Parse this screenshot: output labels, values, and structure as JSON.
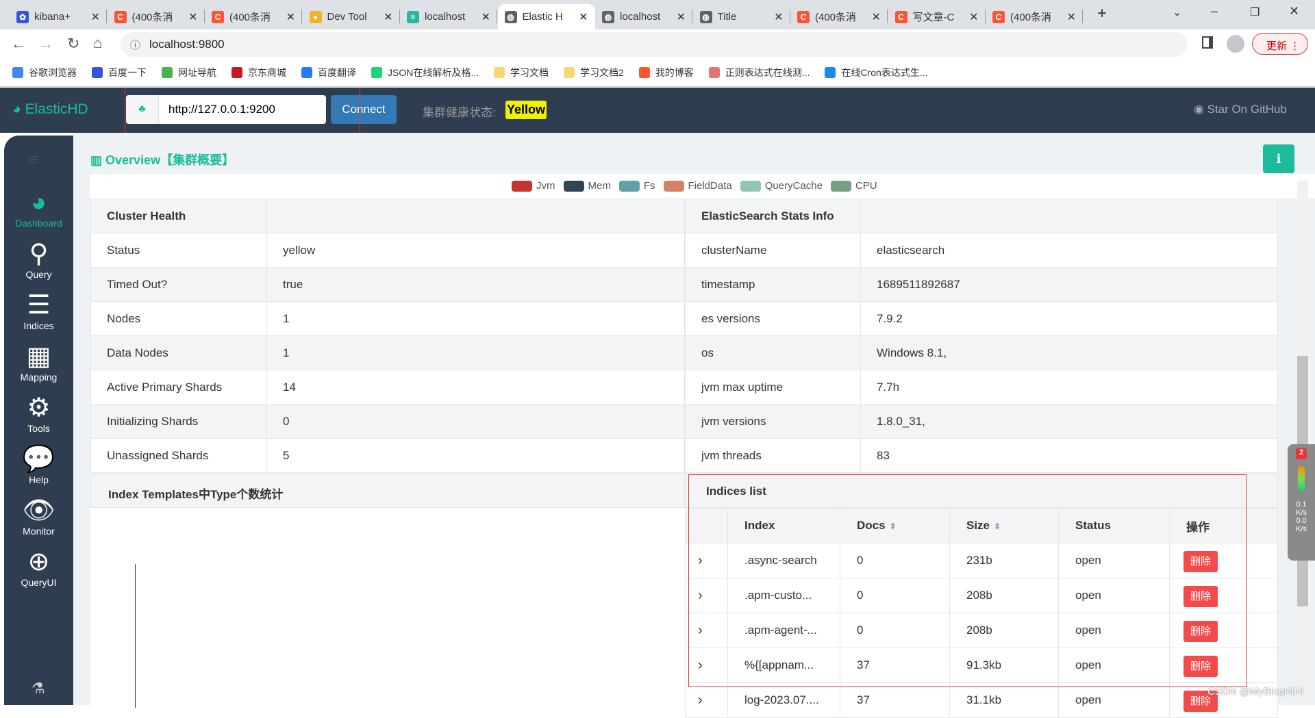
{
  "browser": {
    "tabs": [
      {
        "title": "kibana+",
        "color": "#3355dd",
        "glyph": "✿"
      },
      {
        "title": "(400条消",
        "color": "#fc5531",
        "glyph": "C"
      },
      {
        "title": "(400条消",
        "color": "#fc5531",
        "glyph": "C"
      },
      {
        "title": "Dev Tool",
        "color": "#f0b429",
        "glyph": "●"
      },
      {
        "title": "localhost",
        "color": "#2bb5a4",
        "glyph": "≡"
      },
      {
        "title": "Elastic H",
        "color": "#5f6368",
        "glyph": "◍"
      },
      {
        "title": "localhost",
        "color": "#5f6368",
        "glyph": "◍"
      },
      {
        "title": "Title",
        "color": "#5f6368",
        "glyph": "◍"
      },
      {
        "title": "(400条消",
        "color": "#fc5531",
        "glyph": "C"
      },
      {
        "title": "写文章-C",
        "color": "#fc5531",
        "glyph": "C"
      },
      {
        "title": "(400条消",
        "color": "#fc5531",
        "glyph": "C"
      }
    ],
    "url": "localhost:9800",
    "update_label": "更新",
    "bookmarks": [
      {
        "label": "谷歌浏览器",
        "color": "#4285f4"
      },
      {
        "label": "百度一下",
        "color": "#3355dd"
      },
      {
        "label": "网址导航",
        "color": "#4caf50"
      },
      {
        "label": "京东商城",
        "color": "#c81623"
      },
      {
        "label": "百度翻译",
        "color": "#2979ff"
      },
      {
        "label": "JSON在线解析及格...",
        "color": "#1dd47a"
      },
      {
        "label": "学习文档",
        "color": "#f7d774"
      },
      {
        "label": "学习文档2",
        "color": "#f7d774"
      },
      {
        "label": "我的博客",
        "color": "#fc5531"
      },
      {
        "label": "正则表达式在线测...",
        "color": "#e57373"
      },
      {
        "label": "在线Cron表达式生...",
        "color": "#1e88e5"
      }
    ]
  },
  "app": {
    "brand": "ElasticHD",
    "server_url": "http://127.0.0.1:9200",
    "connect_label": "Connect",
    "health_label": "集群健康状态:",
    "health_value": "Yellow",
    "github_label": "Star On GitHub",
    "colors": {
      "accent": "#1abc9c",
      "nav": "#2e3d50",
      "danger": "#f54a4a",
      "health": "#f0f000"
    }
  },
  "sidebar": {
    "items": [
      {
        "label": "Dashboard",
        "icon": "dashboard-icon",
        "active": true
      },
      {
        "label": "Query",
        "icon": "search-icon"
      },
      {
        "label": "Indices",
        "icon": "list-icon"
      },
      {
        "label": "Mapping",
        "icon": "table-icon"
      },
      {
        "label": "Tools",
        "icon": "gears-icon"
      },
      {
        "label": "Help",
        "icon": "comments-icon"
      },
      {
        "label": "Monitor",
        "icon": "eye-icon"
      },
      {
        "label": "QueryUI",
        "icon": "zoom-in-icon"
      }
    ]
  },
  "overview": {
    "title": "Overview【集群概要】"
  },
  "legend": [
    {
      "label": "Jvm",
      "color": "#c23531"
    },
    {
      "label": "Mem",
      "color": "#2f4554"
    },
    {
      "label": "Fs",
      "color": "#61a0a8"
    },
    {
      "label": "FieldData",
      "color": "#d48265"
    },
    {
      "label": "QueryCache",
      "color": "#91c7ae"
    },
    {
      "label": "CPU",
      "color": "#749f83"
    }
  ],
  "cluster_health": {
    "title": "Cluster Health",
    "rows": [
      [
        "Status",
        "yellow"
      ],
      [
        "Timed Out?",
        "true"
      ],
      [
        "Nodes",
        "1"
      ],
      [
        "Data Nodes",
        "1"
      ],
      [
        "Active Primary Shards",
        "14"
      ],
      [
        "Initializing Shards",
        "0"
      ],
      [
        "Unassigned Shards",
        "5"
      ]
    ]
  },
  "stats_info": {
    "title": "ElasticSearch Stats Info",
    "rows": [
      [
        "clusterName",
        "elasticsearch"
      ],
      [
        "timestamp",
        "1689511892687"
      ],
      [
        "es versions",
        "7.9.2"
      ],
      [
        "os",
        "Windows 8.1,"
      ],
      [
        "jvm max uptime",
        "7.7h"
      ],
      [
        "jvm versions",
        "1.8.0_31,"
      ],
      [
        "jvm threads",
        "83"
      ]
    ]
  },
  "templates": {
    "title": "Index Templates中Type个数统计"
  },
  "indices": {
    "title": "Indices list",
    "headers": [
      "Index",
      "Docs",
      "Size",
      "Status",
      "操作"
    ],
    "delete_label": "删除",
    "rows": [
      [
        ".async-search",
        "0",
        "231b",
        "open"
      ],
      [
        ".apm-custo...",
        "0",
        "208b",
        "open"
      ],
      [
        ".apm-agent-...",
        "0",
        "208b",
        "open"
      ],
      [
        "%{[appnam...",
        "37",
        "91.3kb",
        "open"
      ],
      [
        "log-2023.07....",
        "37",
        "31.1kb",
        "open"
      ]
    ]
  },
  "overlay": {
    "badge": "2",
    "up": "0.1",
    "down": "0.0",
    "unit": "K/s"
  },
  "watermark": "CSDN @MyBlogHiHi"
}
